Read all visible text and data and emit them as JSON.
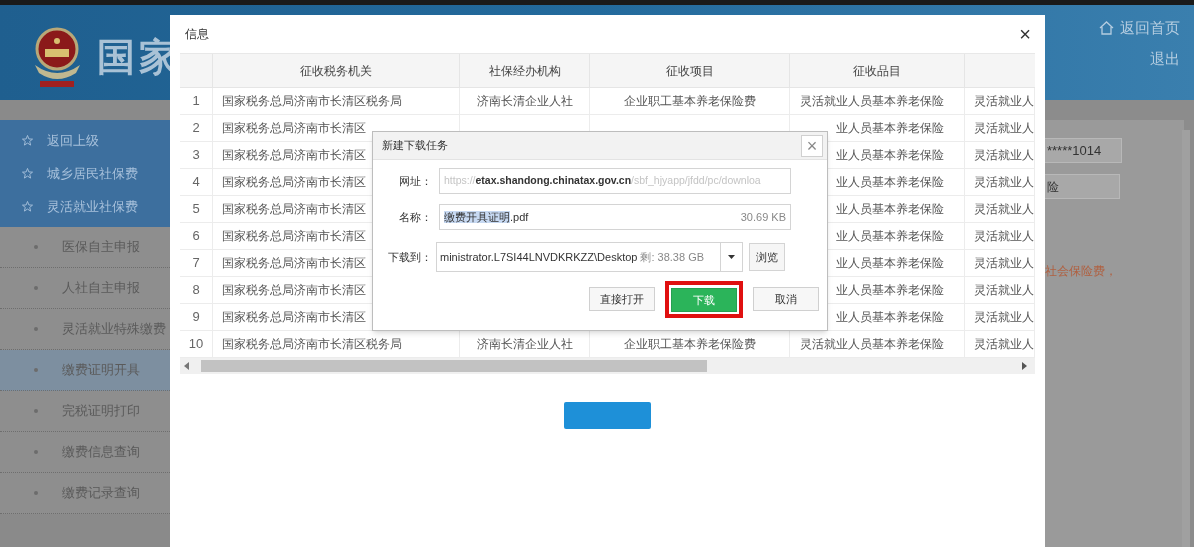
{
  "header": {
    "site_title": "国家",
    "links": [
      {
        "kind": "home",
        "label": "返回首页"
      },
      {
        "kind": "plain",
        "label": "退出"
      }
    ]
  },
  "sidebar": {
    "top_items": [
      "返回上级",
      "城乡居民社保费",
      "灵活就业社保费"
    ],
    "items": [
      {
        "label": "医保自主申报",
        "selected": false
      },
      {
        "label": "人社自主申报",
        "selected": false
      },
      {
        "label": "灵活就业特殊缴费",
        "selected": false
      },
      {
        "label": "缴费证明开具",
        "selected": true
      },
      {
        "label": "完税证明打印",
        "selected": false
      },
      {
        "label": "缴费信息查询",
        "selected": false
      },
      {
        "label": "缴费记录查询",
        "selected": false
      }
    ]
  },
  "background_form": {
    "id_field": "*****1014",
    "type_field": "险",
    "notice": "社会保险费，"
  },
  "info_modal": {
    "title": "信息",
    "close": "×",
    "table": {
      "columns": [
        "征收税务机关",
        "社保经办机构",
        "征收项目",
        "征收品目"
      ],
      "rows": [
        {
          "no": "1",
          "tax_office": "国家税务总局济南市长清区税务局",
          "agency": "济南长清企业人社",
          "item": "企业职工基本养老保险费",
          "category": "灵活就业人员基本养老保险",
          "column_5": "灵活就业人"
        },
        {
          "no": "2",
          "tax_office": "国家税务总局济南市长清区",
          "category": "业人员基本养老保险",
          "column_5": "灵活就业人"
        },
        {
          "no": "3",
          "tax_office": "国家税务总局济南市长清区",
          "category": "业人员基本养老保险",
          "column_5": "灵活就业人"
        },
        {
          "no": "4",
          "tax_office": "国家税务总局济南市长清区",
          "category": "业人员基本养老保险",
          "column_5": "灵活就业人"
        },
        {
          "no": "5",
          "tax_office": "国家税务总局济南市长清区",
          "category": "业人员基本养老保险",
          "column_5": "灵活就业人"
        },
        {
          "no": "6",
          "tax_office": "国家税务总局济南市长清区",
          "category": "业人员基本养老保险",
          "column_5": "灵活就业人"
        },
        {
          "no": "7",
          "tax_office": "国家税务总局济南市长清区",
          "category": "业人员基本养老保险",
          "column_5": "灵活就业人"
        },
        {
          "no": "8",
          "tax_office": "国家税务总局济南市长清区",
          "category": "业人员基本养老保险",
          "column_5": "灵活就业人"
        },
        {
          "no": "9",
          "tax_office": "国家税务总局济南市长清区",
          "category": "业人员基本养老保险",
          "column_5": "灵活就业人"
        },
        {
          "no": "10",
          "tax_office": "国家税务总局济南市长清区税务局",
          "agency": "济南长清企业人社",
          "item": "企业职工基本养老保险费",
          "category": "灵活就业人员基本养老保险",
          "column_5": "灵活就业人"
        }
      ]
    }
  },
  "download_dialog": {
    "title": "新建下载任务",
    "close": "×",
    "url": {
      "label": "网址：",
      "prefix": "https://",
      "domain": "etax.shandong.chinatax.gov.cn",
      "path": "/sbf_hjyapp/jfdd/pc/downloa"
    },
    "name": {
      "label": "名称：",
      "selected_part": "缴费开具证明",
      "rest": ".pdf",
      "size": "30.69 KB"
    },
    "save_to": {
      "label": "下载到：",
      "path": "ministrator.L7SI44LNVDKRKZZ\\Desktop",
      "free": "剩: 38.38 GB",
      "browse": "浏览"
    },
    "buttons": [
      {
        "kind": "plain",
        "label": "直接打开",
        "highlighted": false
      },
      {
        "kind": "primary",
        "label": "下载",
        "highlighted": true
      },
      {
        "kind": "plain",
        "label": "取消",
        "highlighted": false
      }
    ]
  }
}
